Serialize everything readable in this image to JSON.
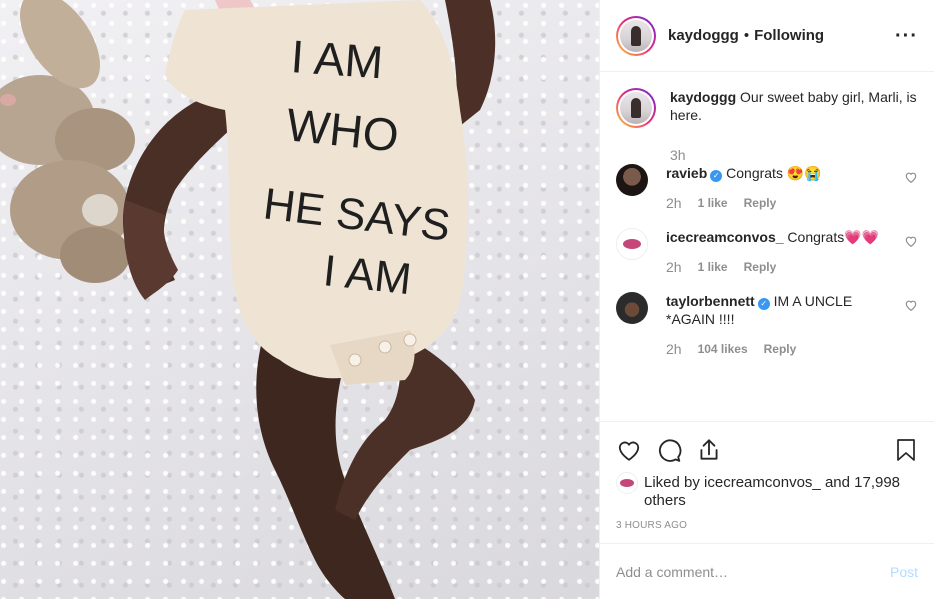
{
  "photo": {
    "onesie_text": [
      "I AM",
      "WHO",
      "HE SAYS",
      "I AM"
    ]
  },
  "header": {
    "username": "kaydoggg",
    "separator": "•",
    "follow_status": "Following",
    "more_icon": "more-horizontal-icon"
  },
  "caption": {
    "username": "kaydoggg",
    "text": "Our sweet baby girl, Marli, is here.",
    "time": "3h"
  },
  "comments": [
    {
      "username": "ravieb",
      "verified": true,
      "text": "Congrats 😍😭",
      "time": "2h",
      "likes": "1 like",
      "reply": "Reply"
    },
    {
      "username": "icecreamconvos_",
      "verified": false,
      "text": "Congrats💗💗",
      "time": "2h",
      "likes": "1 like",
      "reply": "Reply"
    },
    {
      "username": "taylorbennett",
      "verified": true,
      "text": "IM A UNCLE *AGAIN !!!!",
      "time": "2h",
      "likes": "104 likes",
      "reply": "Reply"
    }
  ],
  "actions": {
    "icons": [
      "heart-icon",
      "comment-icon",
      "share-icon",
      "bookmark-icon"
    ],
    "liked_by_prefix": "Liked by",
    "liked_by_user": "icecreamconvos_",
    "liked_by_and": "and",
    "liked_by_others": "17,998 others",
    "timestamp": "3 HOURS AGO"
  },
  "add_comment": {
    "placeholder": "Add a comment…",
    "post_label": "Post"
  },
  "colors": {
    "link_blue": "#3897f0",
    "post_disabled": "#b3dbff",
    "muted": "#8e8e8e"
  }
}
